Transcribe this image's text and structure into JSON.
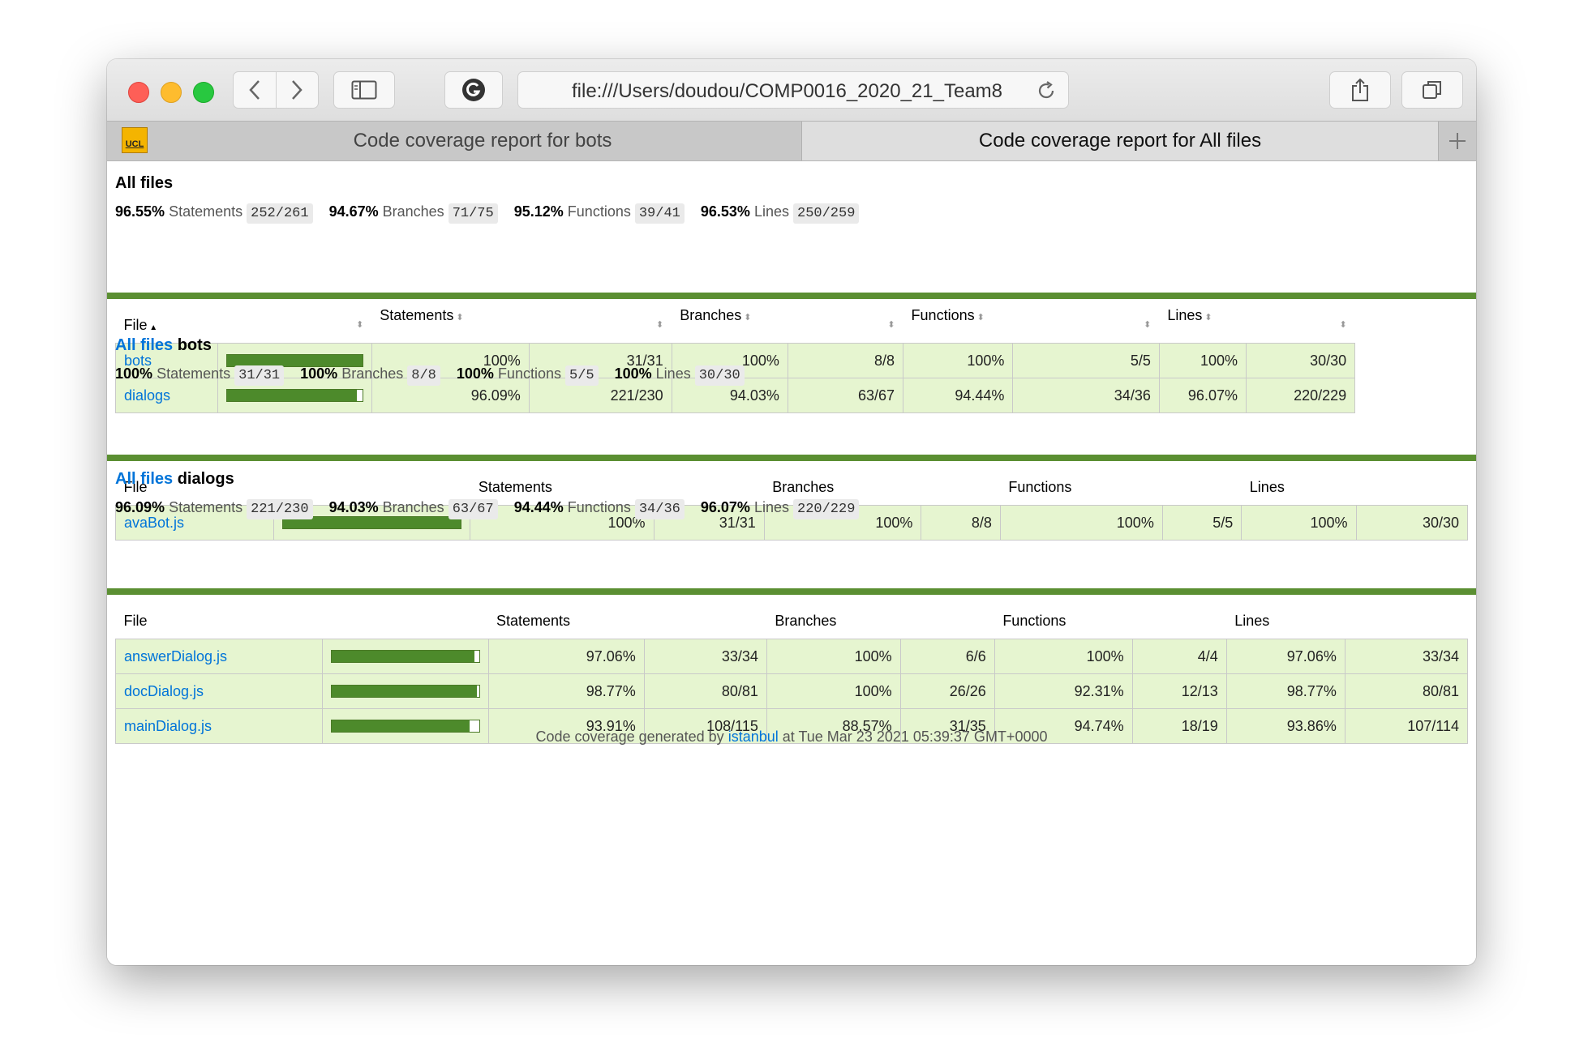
{
  "browser": {
    "url": "file:///Users/doudou/COMP0016_2020_21_Team8",
    "tabs": [
      "Code coverage report for bots",
      "Code coverage report for All files"
    ],
    "favicon_text": "UCL"
  },
  "sections": [
    {
      "link": "",
      "title": "All files",
      "stats": [
        {
          "pct": "96.55%",
          "label": "Statements",
          "frac": "252/261"
        },
        {
          "pct": "94.67%",
          "label": "Branches",
          "frac": "71/75"
        },
        {
          "pct": "95.12%",
          "label": "Functions",
          "frac": "39/41"
        },
        {
          "pct": "96.53%",
          "label": "Lines",
          "frac": "250/259"
        }
      ],
      "headers": [
        "File",
        "Statements",
        "Branches",
        "Functions",
        "Lines"
      ],
      "rows": [
        {
          "file": "bots",
          "bar": 100,
          "st": "100%",
          "stf": "31/31",
          "br": "100%",
          "brf": "8/8",
          "fn": "100%",
          "fnf": "5/5",
          "ln": "100%",
          "lnf": "30/30"
        },
        {
          "file": "dialogs",
          "bar": 96.09,
          "st": "96.09%",
          "stf": "221/230",
          "br": "94.03%",
          "brf": "63/67",
          "fn": "94.44%",
          "fnf": "34/36",
          "ln": "96.07%",
          "lnf": "220/229"
        }
      ]
    },
    {
      "link": "All files",
      "title": "bots",
      "stats": [
        {
          "pct": "100%",
          "label": "Statements",
          "frac": "31/31"
        },
        {
          "pct": "100%",
          "label": "Branches",
          "frac": "8/8"
        },
        {
          "pct": "100%",
          "label": "Functions",
          "frac": "5/5"
        },
        {
          "pct": "100%",
          "label": "Lines",
          "frac": "30/30"
        }
      ],
      "headers": [
        "File",
        "Statements",
        "Branches",
        "Functions",
        "Lines"
      ],
      "rows": [
        {
          "file": "avaBot.js",
          "bar": 100,
          "st": "100%",
          "stf": "31/31",
          "br": "100%",
          "brf": "8/8",
          "fn": "100%",
          "fnf": "5/5",
          "ln": "100%",
          "lnf": "30/30"
        }
      ]
    },
    {
      "link": "All files",
      "title": "dialogs",
      "stats": [
        {
          "pct": "96.09%",
          "label": "Statements",
          "frac": "221/230"
        },
        {
          "pct": "94.03%",
          "label": "Branches",
          "frac": "63/67"
        },
        {
          "pct": "94.44%",
          "label": "Functions",
          "frac": "34/36"
        },
        {
          "pct": "96.07%",
          "label": "Lines",
          "frac": "220/229"
        }
      ],
      "headers": [
        "File",
        "Statements",
        "Branches",
        "Functions",
        "Lines"
      ],
      "rows": [
        {
          "file": "answerDialog.js",
          "bar": 97.06,
          "st": "97.06%",
          "stf": "33/34",
          "br": "100%",
          "brf": "6/6",
          "fn": "100%",
          "fnf": "4/4",
          "ln": "97.06%",
          "lnf": "33/34"
        },
        {
          "file": "docDialog.js",
          "bar": 98.77,
          "st": "98.77%",
          "stf": "80/81",
          "br": "100%",
          "brf": "26/26",
          "fn": "92.31%",
          "fnf": "12/13",
          "ln": "98.77%",
          "lnf": "80/81"
        },
        {
          "file": "mainDialog.js",
          "bar": 93.91,
          "st": "93.91%",
          "stf": "108/115",
          "br": "88.57%",
          "brf": "31/35",
          "fn": "94.74%",
          "fnf": "18/19",
          "ln": "93.86%",
          "lnf": "107/114"
        }
      ]
    }
  ],
  "footer": {
    "prefix": "Code coverage generated by",
    "link": "istanbul",
    "suffix": "at Tue Mar 23 2021 05:39:37 GMT+0000"
  },
  "colors": {
    "accent_bar": "#5b8f32",
    "row_bg": "#e6f5d0",
    "link": "#0074d9"
  }
}
